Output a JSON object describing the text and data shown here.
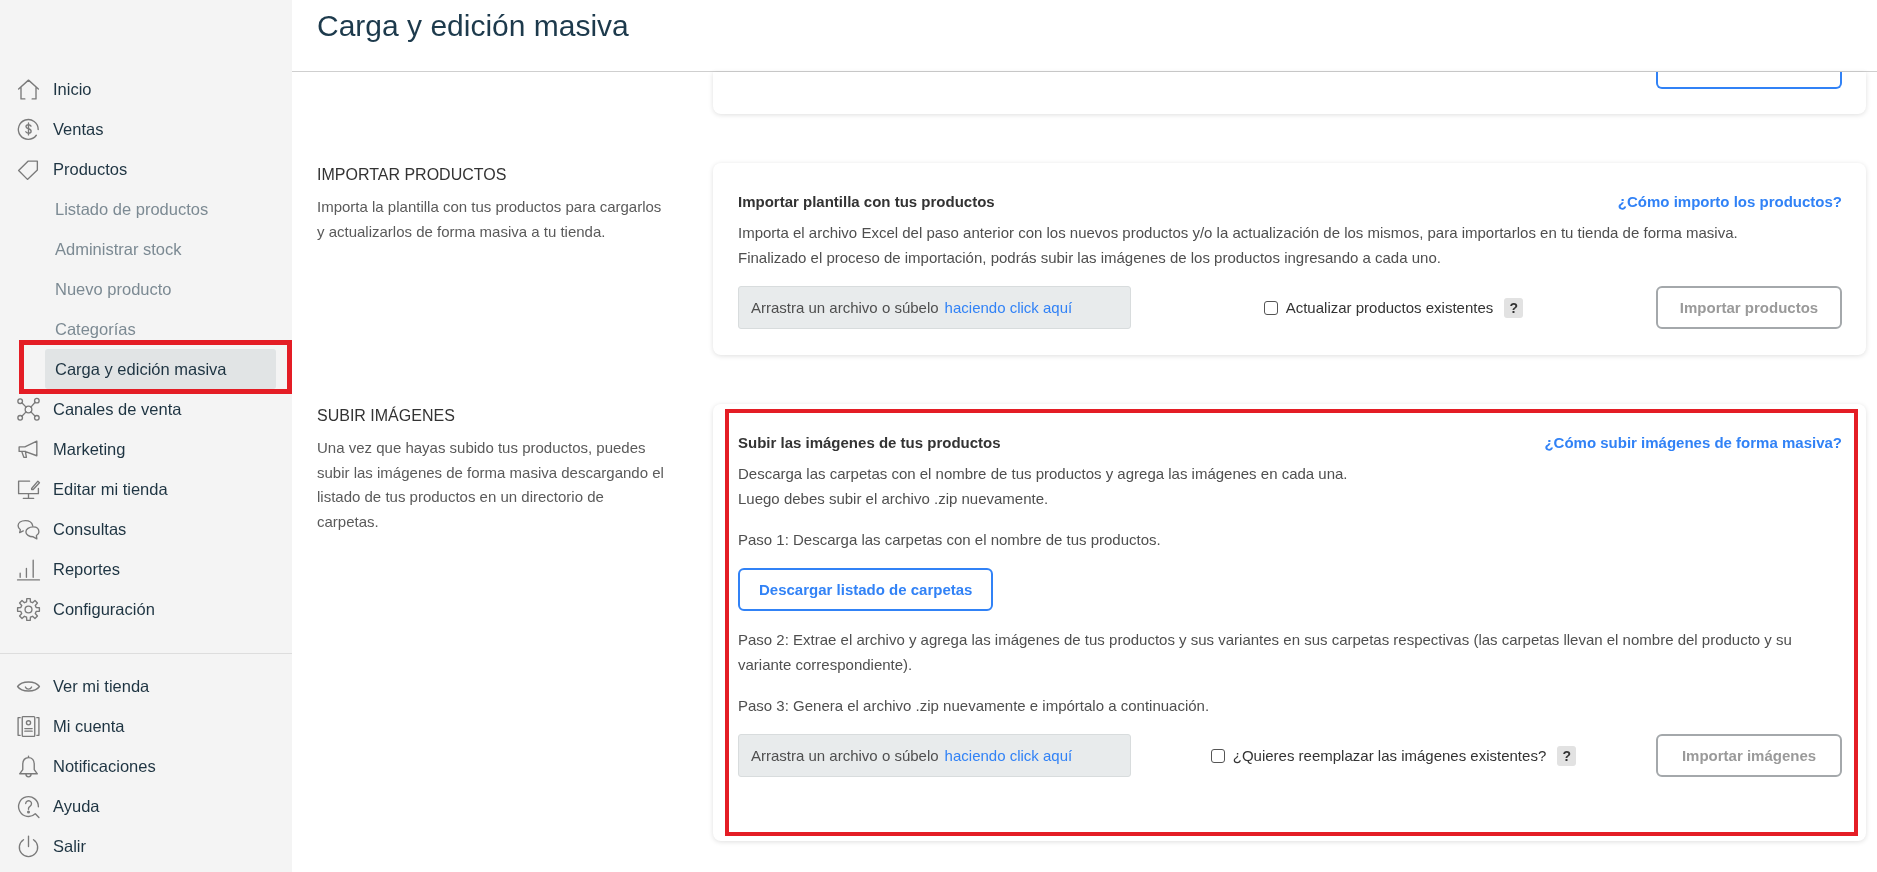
{
  "sidebar": {
    "items": [
      {
        "label": "Inicio",
        "selected": false
      },
      {
        "label": "Ventas",
        "selected": false
      },
      {
        "label": "Productos",
        "selected": false,
        "children": [
          {
            "label": "Listado de productos",
            "selected": false,
            "highlighted": false
          },
          {
            "label": "Administrar stock",
            "selected": false,
            "highlighted": false
          },
          {
            "label": "Nuevo producto",
            "selected": false,
            "highlighted": false
          },
          {
            "label": "Categorías",
            "selected": false,
            "highlighted": false
          },
          {
            "label": "Carga y edición masiva",
            "selected": true,
            "highlighted": true
          }
        ]
      },
      {
        "label": "Canales de venta",
        "selected": false
      },
      {
        "label": "Marketing",
        "selected": false
      },
      {
        "label": "Editar mi tienda",
        "selected": false
      },
      {
        "label": "Consultas",
        "selected": false
      },
      {
        "label": "Reportes",
        "selected": false
      },
      {
        "label": "Configuración",
        "selected": false
      }
    ],
    "footer_items": [
      {
        "label": "Ver mi tienda",
        "selected": false
      },
      {
        "label": "Mi cuenta",
        "selected": false
      },
      {
        "label": "Notificaciones",
        "selected": false
      },
      {
        "label": "Ayuda",
        "selected": false
      },
      {
        "label": "Salir",
        "selected": false
      }
    ]
  },
  "header": {
    "title": "Carga y edición masiva"
  },
  "sections": [
    {
      "heading": "IMPORTAR PRODUCTOS",
      "description": "Importa la plantilla con tus productos para cargarlos y actualizarlos de forma masiva a tu tienda.",
      "highlighted": false,
      "card": {
        "title": "Importar plantilla con tus productos",
        "help_link": "¿Cómo importo los productos?",
        "blocks": [
          {
            "kind": "text",
            "lines": [
              "Importa el archivo Excel del paso anterior con los nuevos productos y/o la actualización de los mismos, para importarlos en tu tienda de forma masiva.",
              "Finalizado el proceso de importación, podrás subir las imágenes de los productos ingresando a cada uno."
            ]
          },
          {
            "kind": "upload",
            "dropzone_text": "Arrastra un archivo o súbelo",
            "dropzone_link": "haciendo click aquí",
            "option": {
              "label": "Actualizar productos existentes",
              "checked": false,
              "help": "?"
            },
            "button": {
              "label": "Importar productos",
              "disabled": true
            }
          }
        ]
      }
    },
    {
      "heading": "SUBIR IMÁGENES",
      "description": "Una vez que hayas subido tus productos, puedes subir las imágenes de forma masiva descargando el listado de tus productos en un directorio de carpetas.",
      "highlighted": true,
      "card": {
        "title": "Subir las imágenes de tus productos",
        "help_link": "¿Cómo subir imágenes de forma masiva?",
        "blocks": [
          {
            "kind": "text",
            "lines": [
              "Descarga las carpetas con el nombre de tus productos y agrega las imágenes en cada una.",
              "Luego debes subir el archivo .zip nuevamente."
            ]
          },
          {
            "kind": "text",
            "lines": [
              "Paso 1: Descarga las carpetas con el nombre de tus productos."
            ]
          },
          {
            "kind": "button",
            "label": "Descargar listado de carpetas",
            "disabled": false
          },
          {
            "kind": "text",
            "lines": [
              "Paso 2: Extrae el archivo y agrega las imágenes de tus productos y sus variantes en sus carpetas respectivas (las carpetas llevan el nombre del producto y su variante correspondiente)."
            ]
          },
          {
            "kind": "text",
            "lines": [
              "Paso 3: Genera el archivo .zip nuevamente e impórtalo a continuación."
            ]
          },
          {
            "kind": "upload",
            "dropzone_text": "Arrastra un archivo o súbelo",
            "dropzone_link": "haciendo click aquí",
            "option": {
              "label": "¿Quieres reemplazar las imágenes existentes?",
              "checked": false,
              "help": "?"
            },
            "button": {
              "label": "Importar imágenes",
              "disabled": true
            }
          }
        ]
      }
    }
  ]
}
